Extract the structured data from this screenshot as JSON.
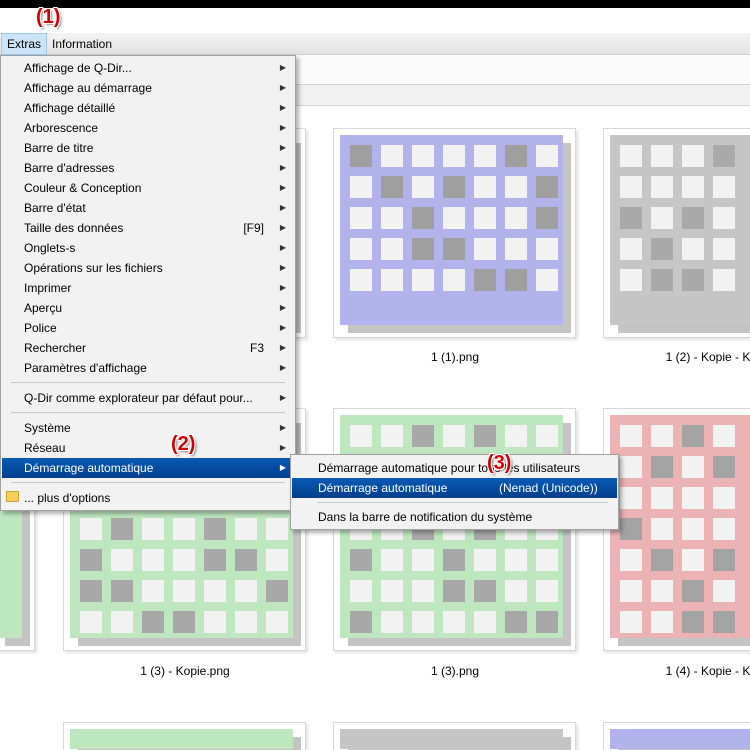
{
  "annotations": [
    "(1)",
    "(2)",
    "(3)"
  ],
  "menubar": {
    "items": [
      "Extras",
      "Information"
    ]
  },
  "extras_menu": {
    "items": [
      {
        "label": "Affichage de Q-Dir...",
        "shortcut": "",
        "submenu": true
      },
      {
        "label": "Affichage au démarrage",
        "shortcut": "",
        "submenu": true
      },
      {
        "label": "Affichage détaillé",
        "shortcut": "",
        "submenu": true
      },
      {
        "label": "Arborescence",
        "shortcut": "",
        "submenu": true
      },
      {
        "label": "Barre de titre",
        "shortcut": "",
        "submenu": true
      },
      {
        "label": "Barre d'adresses",
        "shortcut": "",
        "submenu": true
      },
      {
        "label": "Couleur & Conception",
        "shortcut": "",
        "submenu": true
      },
      {
        "label": "Barre d'état",
        "shortcut": "",
        "submenu": true
      },
      {
        "label": "Taille des données",
        "shortcut": "[F9]",
        "submenu": true
      },
      {
        "label": "Onglets-s",
        "shortcut": "",
        "submenu": true
      },
      {
        "label": "Opérations sur les fichiers",
        "shortcut": "",
        "submenu": true
      },
      {
        "label": "Imprimer",
        "shortcut": "",
        "submenu": true
      },
      {
        "label": "Aperçu",
        "shortcut": "",
        "submenu": true
      },
      {
        "label": "Police",
        "shortcut": "",
        "submenu": true
      },
      {
        "label": "Rechercher",
        "shortcut": "F3",
        "submenu": true
      },
      {
        "label": "Paramètres d'affichage",
        "shortcut": "",
        "submenu": true
      },
      {
        "label": "Q-Dir comme explorateur par défaut pour...",
        "shortcut": "",
        "submenu": true
      },
      {
        "label": "Système",
        "shortcut": "",
        "submenu": true
      },
      {
        "label": "Réseau",
        "shortcut": "",
        "submenu": true
      },
      {
        "label": "Démarrage automatique",
        "shortcut": "",
        "submenu": true,
        "highlighted": true
      },
      {
        "label": "... plus d'options",
        "shortcut": "",
        "submenu": false
      }
    ]
  },
  "autostart_submenu": {
    "items": [
      {
        "label": "Démarrage automatique pour tous les utilisateurs",
        "extra": ""
      },
      {
        "label": "Démarrage automatique",
        "extra": "(Nenad (Unicode))",
        "highlighted": true
      },
      {
        "label": "Dans la barre de notification du système",
        "extra": ""
      }
    ]
  },
  "files": [
    {
      "caption": "1 (1).png",
      "color": "#b3b3ec"
    },
    {
      "caption": "1 (2) - Kopie - K",
      "color": "#c6c6c6"
    },
    {
      "caption": "1 (3) - Kopie.png",
      "color": "#bfe7bf"
    },
    {
      "caption": "1 (3).png",
      "color": "#bfe7bf"
    },
    {
      "caption": "1 (4) - Kopie - K",
      "color": "#ebb3b3"
    }
  ],
  "colors": {
    "accent": "#0a5bb5",
    "annotation": "#d40000"
  }
}
